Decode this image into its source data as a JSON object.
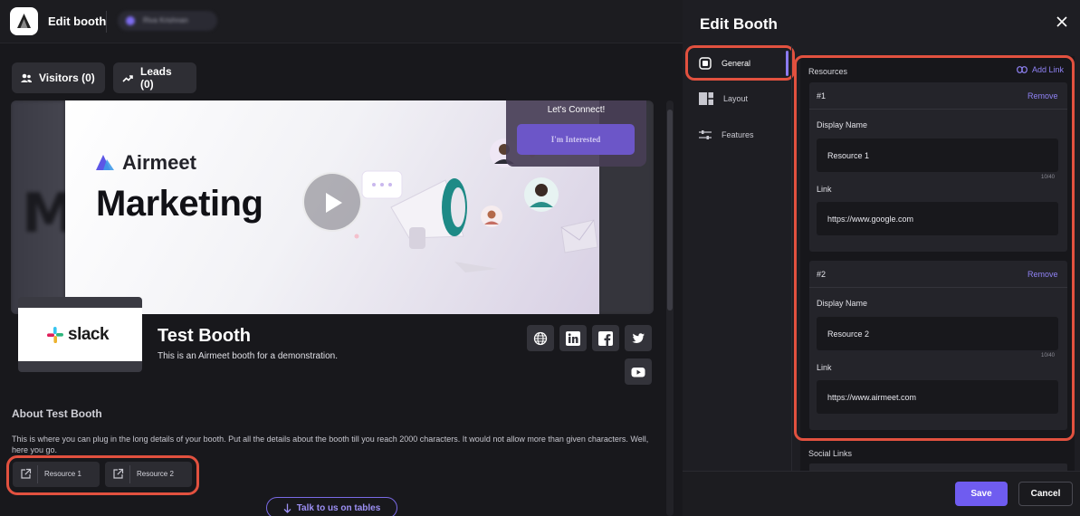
{
  "app": {
    "title": "Edit booth",
    "user_chip": "Riva Krishnan"
  },
  "tabs": [
    {
      "label": "Visitors (0)",
      "icon": "users-icon"
    },
    {
      "label": "Leads (0)",
      "icon": "trend-up-icon"
    }
  ],
  "banner": {
    "brand": "Airmeet",
    "title": "Marketing",
    "connect_title": "Let's Connect!",
    "interest_button": "I'm Interested"
  },
  "booth": {
    "logo_text": "slack",
    "name": "Test Booth",
    "description": "This is an Airmeet booth for a demonstration.",
    "socials": [
      "website-icon",
      "linkedin-icon",
      "facebook-icon",
      "twitter-icon",
      "youtube-icon"
    ],
    "about_title": "About Test Booth",
    "about_body": "This is where you can plug in the long details of your booth. Put all the details about the booth till you reach 2000 characters. It would not allow more than given characters. Well, here you go.",
    "resources": [
      "Resource 1",
      "Resource 2"
    ],
    "talk_button": "Talk to us on tables"
  },
  "panel": {
    "title": "Edit Booth",
    "nav": [
      {
        "label": "General",
        "icon": "general-icon",
        "active": true
      },
      {
        "label": "Layout",
        "icon": "layout-icon",
        "active": false
      },
      {
        "label": "Features",
        "icon": "sliders-icon",
        "active": false
      }
    ],
    "resources_title": "Resources",
    "add_link": "Add Link",
    "resource_cards": [
      {
        "num": "#1",
        "remove": "Remove",
        "display_label": "Display Name",
        "display_value": "Resource 1",
        "count": "10/40",
        "link_label": "Link",
        "link_value": "https://www.google.com"
      },
      {
        "num": "#2",
        "remove": "Remove",
        "display_label": "Display Name",
        "display_value": "Resource 2",
        "count": "10/40",
        "link_label": "Link",
        "link_value": "https://www.airmeet.com"
      }
    ],
    "social_links_title": "Social Links",
    "save": "Save",
    "cancel": "Cancel"
  },
  "colors": {
    "accent": "#6f5cf0",
    "highlight": "#e2513f",
    "background": "#18181c"
  }
}
